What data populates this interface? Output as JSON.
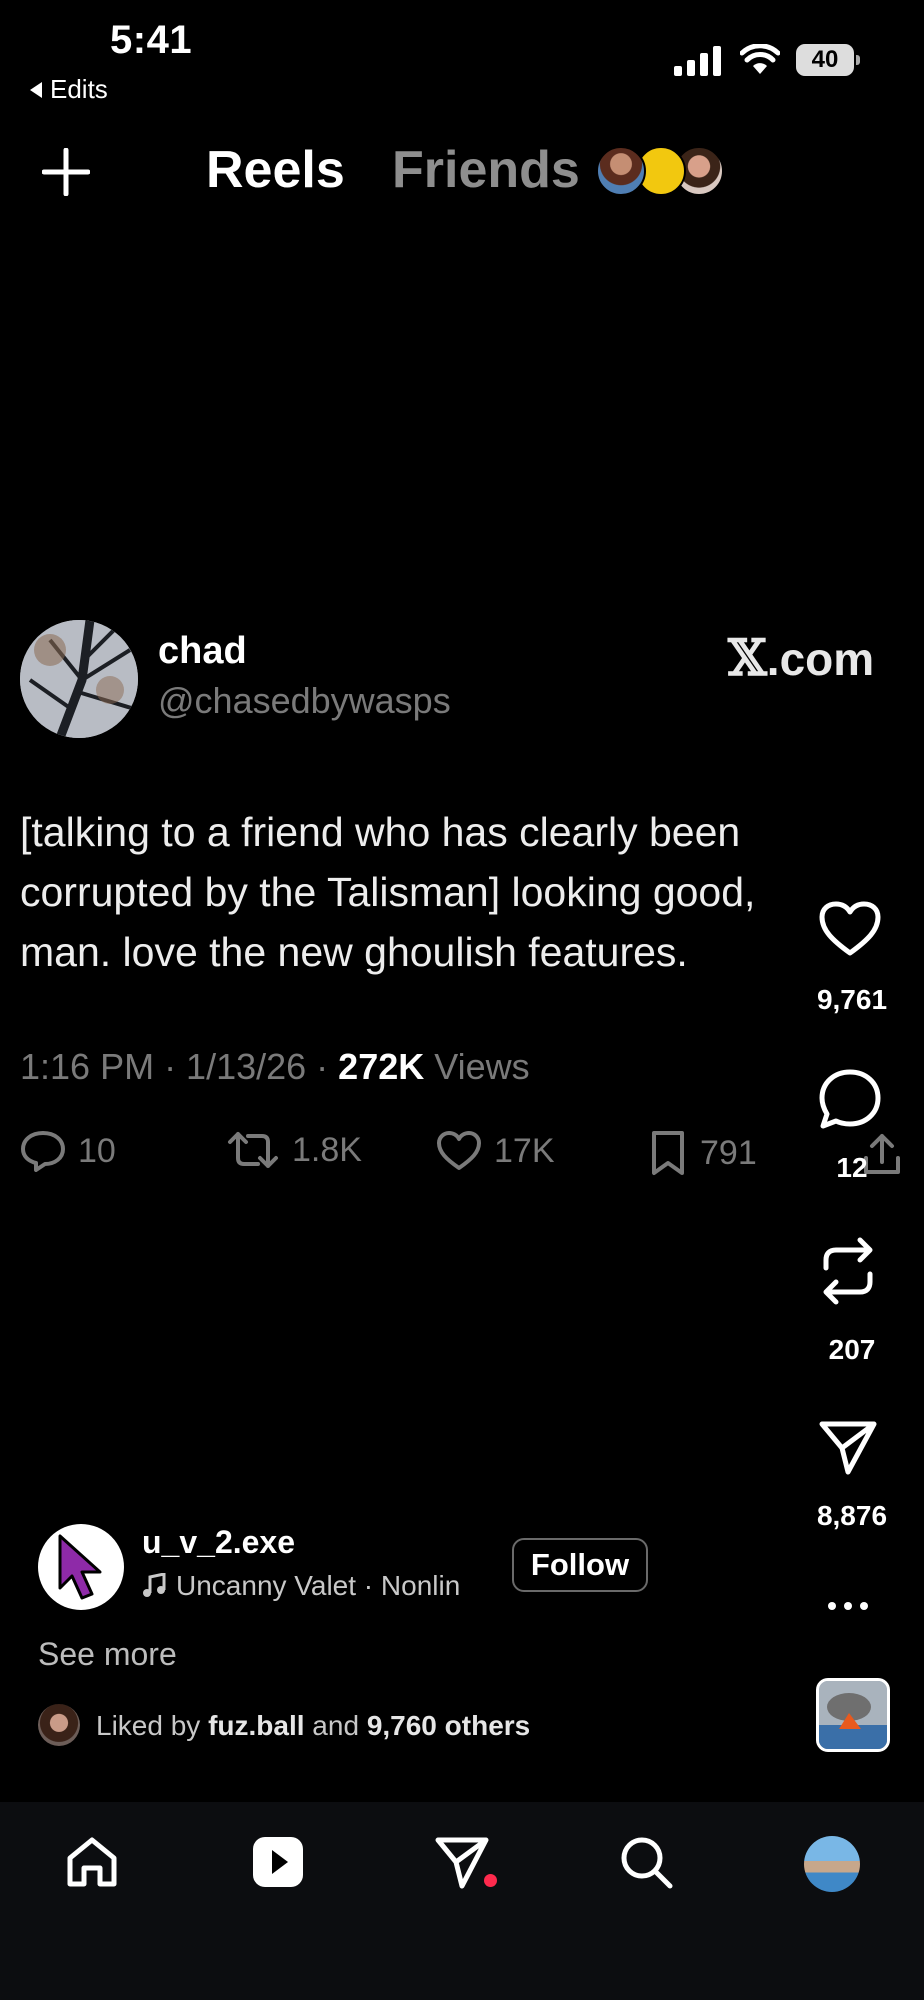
{
  "status_bar": {
    "time": "5:41",
    "back_label": "Edits",
    "battery": "40"
  },
  "header": {
    "tabs": [
      {
        "label": "Reels",
        "active": true
      },
      {
        "label": "Friends",
        "active": false
      }
    ]
  },
  "tweet": {
    "name": "chad",
    "handle": "@chasedbywasps",
    "site_prefix": "𝕏",
    "site_suffix": ".com",
    "text": "[talking to a friend who has clearly been corrupted by the Talisman] looking good, man. love the new ghoulish features.",
    "meta_time": "1:16 PM · 1/13/26 · ",
    "views_count": "272K",
    "views_label": " Views",
    "stats": {
      "replies": "10",
      "reposts": "1.8K",
      "likes": "17K",
      "bookmarks": "791"
    }
  },
  "rail": {
    "likes": "9,761",
    "comments": "12",
    "reposts": "207",
    "shares": "8,876"
  },
  "reel": {
    "username": "u_v_2.exe",
    "audio": "Uncanny Valet · Nonlin",
    "follow_label": "Follow",
    "see_more": "See more",
    "liked_prefix": "Liked by ",
    "liked_user": "fuz.ball",
    "liked_mid": " and ",
    "liked_others": "9,760 others"
  },
  "colors": {
    "background": "#000000",
    "muted": "#7a7a7a",
    "notification_dot": "#ff2a4d"
  },
  "icons": {
    "header": [
      "plus-icon"
    ],
    "tweet": [
      "reply-icon",
      "retweet-icon",
      "like-icon",
      "bookmark-icon",
      "share-icon"
    ],
    "rail": [
      "heart-icon",
      "comment-icon",
      "repost-icon",
      "send-icon",
      "more-icon"
    ],
    "nav": [
      "home-icon",
      "reels-icon",
      "direct-messages-icon",
      "search-icon",
      "profile-avatar"
    ]
  }
}
